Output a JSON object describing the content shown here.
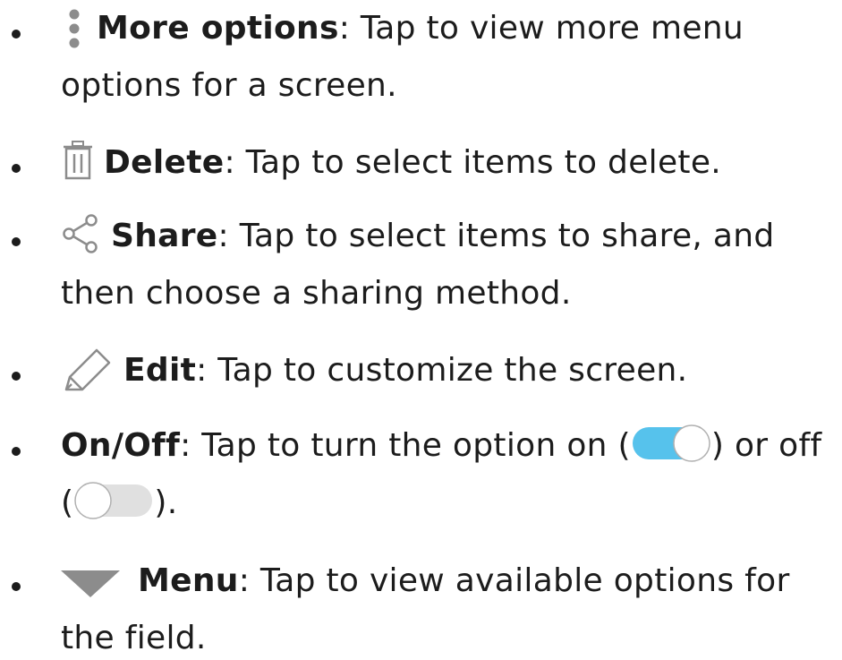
{
  "items": [
    {
      "icon": "more-options-icon",
      "term": "More options",
      "text": ": Tap to view more menu options for a screen."
    },
    {
      "icon": "delete-icon",
      "term": "Delete",
      "text": ": Tap to select items to delete."
    },
    {
      "icon": "share-icon",
      "term": "Share",
      "text": ": Tap to select items to share, and then choose a sharing method."
    },
    {
      "icon": "edit-icon",
      "term": "Edit",
      "text": ": Tap to customize the screen."
    },
    {
      "icon": "",
      "term": "On/Off",
      "text_before": ": Tap to turn the option on (",
      "text_middle": ") or off (",
      "text_after": ")."
    },
    {
      "icon": "menu-icon",
      "term": "Menu",
      "text": ": Tap to view available options for the field."
    }
  ],
  "colors": {
    "text": "#1c1c1c",
    "toggle_on": "#56c2ec",
    "toggle_off": "#e0e0e0",
    "icon_gray": "#8c8c8c"
  }
}
